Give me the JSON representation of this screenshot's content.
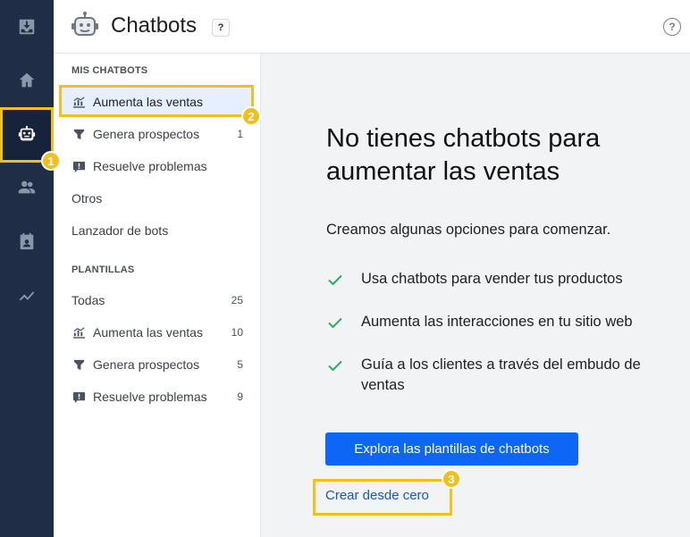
{
  "header": {
    "title": "Chatbots",
    "title_help": "?",
    "help": "?"
  },
  "rail": {
    "items": [
      {
        "icon": "inbox-icon"
      },
      {
        "icon": "home-icon"
      },
      {
        "icon": "chatbot-icon",
        "active": true
      },
      {
        "icon": "contacts-icon"
      },
      {
        "icon": "clipboard-icon"
      },
      {
        "icon": "analytics-icon"
      }
    ]
  },
  "sidebar": {
    "my_chatbots_label": "MIS CHATBOTS",
    "my_chatbots": [
      {
        "label": "Aumenta las ventas",
        "icon": "sales-chart-icon",
        "count": "",
        "active": true
      },
      {
        "label": "Genera prospectos",
        "icon": "funnel-icon",
        "count": "1"
      },
      {
        "label": "Resuelve problemas",
        "icon": "support-chat-icon",
        "count": ""
      }
    ],
    "others": "Otros",
    "bot_launcher": "Lanzador de bots",
    "templates_label": "PLANTILLAS",
    "templates": [
      {
        "label": "Todas",
        "icon": "",
        "count": "25"
      },
      {
        "label": "Aumenta las ventas",
        "icon": "sales-chart-icon",
        "count": "10"
      },
      {
        "label": "Genera prospectos",
        "icon": "funnel-icon",
        "count": "5"
      },
      {
        "label": "Resuelve problemas",
        "icon": "support-chat-icon",
        "count": "9"
      }
    ]
  },
  "main": {
    "heading": "No tienes chatbots para aumentar las ventas",
    "intro": "Creamos algunas opciones para comenzar.",
    "checks": [
      "Usa chatbots para vender tus productos",
      "Aumenta las interacciones en tu sitio web",
      "Guía a los clientes a través del embudo de ventas"
    ],
    "primary_button": "Explora las plantillas de chatbots",
    "secondary_link": "Crear desde cero"
  },
  "colors": {
    "rail_bg": "#1f2d46",
    "accent_blue": "#0d66f6",
    "check_green": "#2eaa5f",
    "highlight": "#f2c01d"
  },
  "callouts": [
    "1",
    "2",
    "3"
  ]
}
